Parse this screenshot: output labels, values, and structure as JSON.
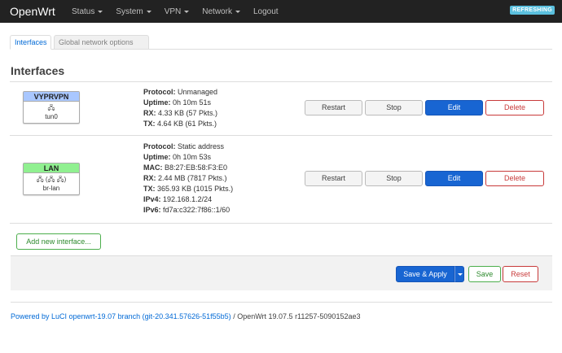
{
  "header": {
    "brand": "OpenWrt",
    "menu": [
      {
        "label": "Status",
        "dropdown": true
      },
      {
        "label": "System",
        "dropdown": true
      },
      {
        "label": "VPN",
        "dropdown": true
      },
      {
        "label": "Network",
        "dropdown": true
      },
      {
        "label": "Logout",
        "dropdown": false
      }
    ],
    "refresh_badge": "REFRESHING"
  },
  "tabs": [
    {
      "label": "Interfaces",
      "active": true
    },
    {
      "label": "Global network options",
      "active": false
    }
  ],
  "page_title": "Interfaces",
  "interfaces": [
    {
      "name": "VYPRVPN",
      "icons": "🖧",
      "device": "tun0",
      "details": [
        {
          "key": "Protocol:",
          "value": "Unmanaged"
        },
        {
          "key": "Uptime:",
          "value": "0h 10m 51s"
        },
        {
          "key": "RX:",
          "value": "4.33 KB (57 Pkts.)"
        },
        {
          "key": "TX:",
          "value": "4.64 KB (61 Pkts.)"
        }
      ]
    },
    {
      "name": "LAN",
      "icons": "🖧 (🖧 🖧)",
      "device": "br-lan",
      "details": [
        {
          "key": "Protocol:",
          "value": "Static address"
        },
        {
          "key": "Uptime:",
          "value": "0h 10m 53s"
        },
        {
          "key": "MAC:",
          "value": "B8:27:EB:58:F3:E0"
        },
        {
          "key": "RX:",
          "value": "2.44 MB (7817 Pkts.)"
        },
        {
          "key": "TX:",
          "value": "365.93 KB (1015 Pkts.)"
        },
        {
          "key": "IPv4:",
          "value": "192.168.1.2/24"
        },
        {
          "key": "IPv6:",
          "value": "fd7a:c322:7f86::1/60"
        }
      ]
    }
  ],
  "row_buttons": {
    "restart": "Restart",
    "stop": "Stop",
    "edit": "Edit",
    "delete": "Delete"
  },
  "add_interface_label": "Add new interface...",
  "actions": {
    "save_apply": "Save & Apply",
    "save": "Save",
    "reset": "Reset"
  },
  "footer": {
    "link_text": "Powered by LuCI openwrt-19.07 branch (git-20.341.57626-51f55b5)",
    "version_text": " / OpenWrt 19.07.5 r11257-5090152ae3"
  },
  "colors": {
    "topbar": "#222222",
    "primary": "#1865d2",
    "danger": "#c83a3a",
    "success": "#4cae4c",
    "vpn_header": "#a9c7ff",
    "lan_header": "#90f090",
    "refresh_badge": "#5bc0de"
  }
}
